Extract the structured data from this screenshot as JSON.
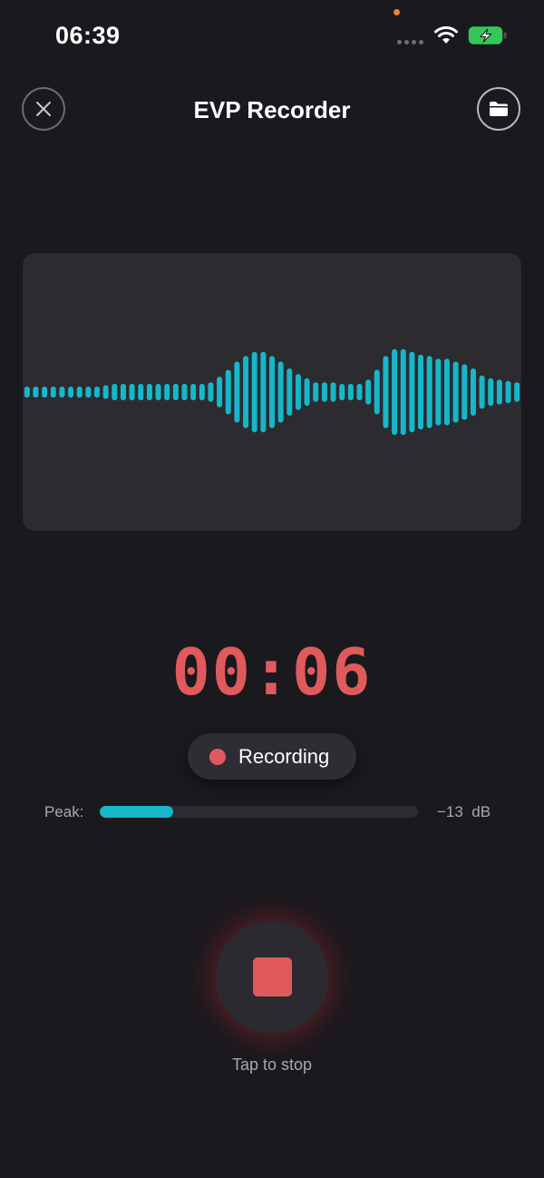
{
  "status_bar": {
    "time": "06:39"
  },
  "header": {
    "title": "EVP Recorder",
    "close_icon": "close-icon",
    "folder_icon": "folder-icon"
  },
  "waveform": {
    "color": "#16b7c9",
    "levels": [
      0.04,
      0.04,
      0.04,
      0.04,
      0.04,
      0.04,
      0.04,
      0.04,
      0.04,
      0.05,
      0.06,
      0.06,
      0.06,
      0.06,
      0.06,
      0.06,
      0.06,
      0.06,
      0.06,
      0.06,
      0.06,
      0.07,
      0.11,
      0.16,
      0.22,
      0.26,
      0.29,
      0.29,
      0.26,
      0.22,
      0.17,
      0.13,
      0.1,
      0.07,
      0.07,
      0.07,
      0.06,
      0.06,
      0.06,
      0.09,
      0.16,
      0.26,
      0.31,
      0.31,
      0.29,
      0.27,
      0.26,
      0.24,
      0.24,
      0.22,
      0.2,
      0.17,
      0.12,
      0.1,
      0.09,
      0.08,
      0.07
    ]
  },
  "timer": {
    "value": "00:06",
    "color": "#e05a5c"
  },
  "status": {
    "label": "Recording"
  },
  "peak": {
    "label": "Peak:",
    "level_fraction": 0.23,
    "value": "−13  dB"
  },
  "stop": {
    "caption": "Tap to stop"
  }
}
